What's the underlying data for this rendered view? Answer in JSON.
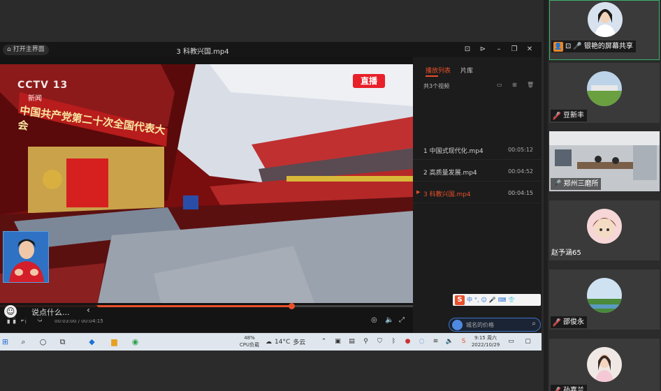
{
  "player": {
    "home_label": "打开主界面",
    "title": "3 科教兴国.mp4",
    "time_current": "00:03:00",
    "time_total": "00:04:15",
    "progress": 0.706
  },
  "video": {
    "channel_logo": "CCTV 13",
    "channel_sub": "新闻",
    "banner": "中国共产党第二十次全国代表大会",
    "live_badge": "直播"
  },
  "playlist": {
    "tabs": [
      {
        "label": "播放列表"
      },
      {
        "label": "片库"
      }
    ],
    "count_label": "共3个视频",
    "items": [
      {
        "name": "1 中国式现代化.mp4",
        "duration": "00:05:12"
      },
      {
        "name": "2 高质量发展.mp4",
        "duration": "00:04:52"
      },
      {
        "name": "3 科教兴国.mp4",
        "duration": "00:04:15"
      }
    ]
  },
  "danmaku": {
    "placeholder": "说点什么..."
  },
  "search": {
    "placeholder": "城名的价格"
  },
  "ime": {
    "logo": "S",
    "labels": [
      "中",
      "°,",
      "☺",
      "🎤",
      "⌨",
      "👕"
    ]
  },
  "taskbar": {
    "cpu_percent": "48%",
    "cpu_label": "CPU负载",
    "temp": "14°C",
    "weather": "多云",
    "time": "9:15 周六",
    "date": "2022/10/29"
  },
  "participants": [
    {
      "name": "银艳的屏幕共享",
      "mic": "on"
    },
    {
      "name": "豆新丰",
      "mic": "off"
    },
    {
      "name": "郑州三磨所",
      "mic": "on"
    },
    {
      "name": "赵予涵65",
      "mic": "none"
    },
    {
      "name": "邵俊永",
      "mic": "off"
    },
    {
      "name": "孙嘉兰",
      "mic": "off"
    }
  ],
  "colors": {
    "accent": "#e8502a",
    "highlight": "#3b73c6"
  }
}
